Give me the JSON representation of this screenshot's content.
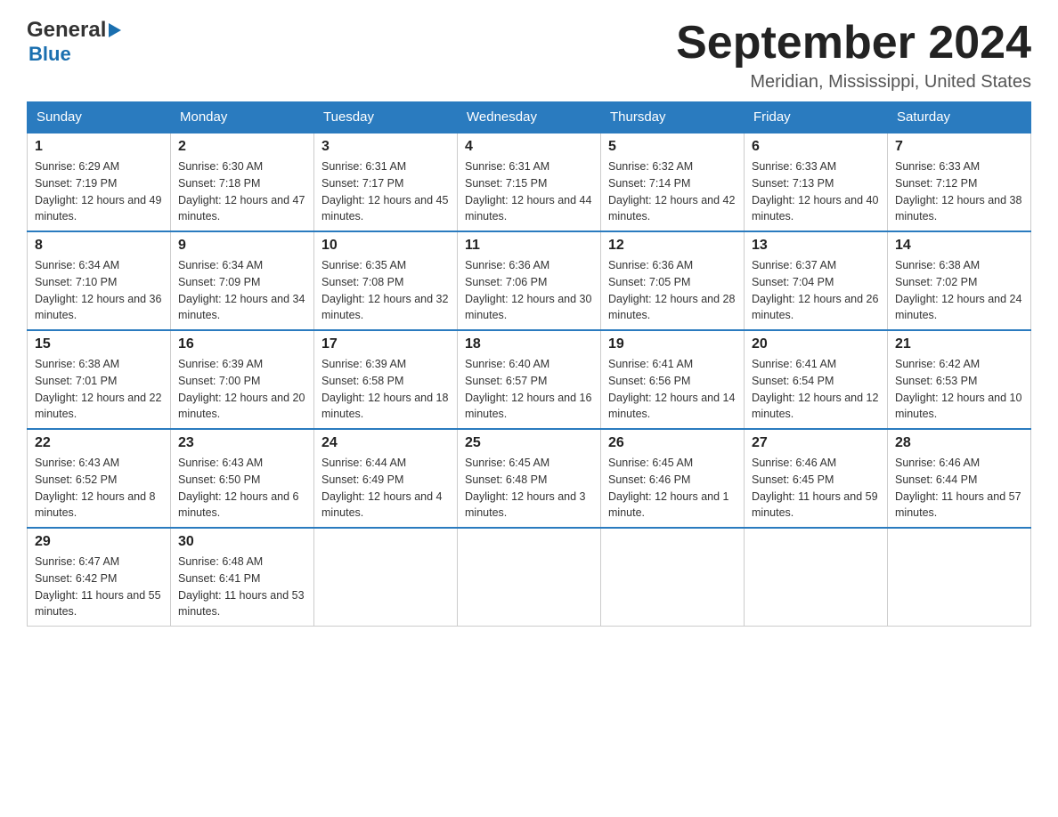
{
  "header": {
    "month_title": "September 2024",
    "location": "Meridian, Mississippi, United States",
    "logo_general": "General",
    "logo_blue": "Blue"
  },
  "days_of_week": [
    "Sunday",
    "Monday",
    "Tuesday",
    "Wednesday",
    "Thursday",
    "Friday",
    "Saturday"
  ],
  "weeks": [
    [
      {
        "day": "1",
        "sunrise": "6:29 AM",
        "sunset": "7:19 PM",
        "daylight": "12 hours and 49 minutes."
      },
      {
        "day": "2",
        "sunrise": "6:30 AM",
        "sunset": "7:18 PM",
        "daylight": "12 hours and 47 minutes."
      },
      {
        "day": "3",
        "sunrise": "6:31 AM",
        "sunset": "7:17 PM",
        "daylight": "12 hours and 45 minutes."
      },
      {
        "day": "4",
        "sunrise": "6:31 AM",
        "sunset": "7:15 PM",
        "daylight": "12 hours and 44 minutes."
      },
      {
        "day": "5",
        "sunrise": "6:32 AM",
        "sunset": "7:14 PM",
        "daylight": "12 hours and 42 minutes."
      },
      {
        "day": "6",
        "sunrise": "6:33 AM",
        "sunset": "7:13 PM",
        "daylight": "12 hours and 40 minutes."
      },
      {
        "day": "7",
        "sunrise": "6:33 AM",
        "sunset": "7:12 PM",
        "daylight": "12 hours and 38 minutes."
      }
    ],
    [
      {
        "day": "8",
        "sunrise": "6:34 AM",
        "sunset": "7:10 PM",
        "daylight": "12 hours and 36 minutes."
      },
      {
        "day": "9",
        "sunrise": "6:34 AM",
        "sunset": "7:09 PM",
        "daylight": "12 hours and 34 minutes."
      },
      {
        "day": "10",
        "sunrise": "6:35 AM",
        "sunset": "7:08 PM",
        "daylight": "12 hours and 32 minutes."
      },
      {
        "day": "11",
        "sunrise": "6:36 AM",
        "sunset": "7:06 PM",
        "daylight": "12 hours and 30 minutes."
      },
      {
        "day": "12",
        "sunrise": "6:36 AM",
        "sunset": "7:05 PM",
        "daylight": "12 hours and 28 minutes."
      },
      {
        "day": "13",
        "sunrise": "6:37 AM",
        "sunset": "7:04 PM",
        "daylight": "12 hours and 26 minutes."
      },
      {
        "day": "14",
        "sunrise": "6:38 AM",
        "sunset": "7:02 PM",
        "daylight": "12 hours and 24 minutes."
      }
    ],
    [
      {
        "day": "15",
        "sunrise": "6:38 AM",
        "sunset": "7:01 PM",
        "daylight": "12 hours and 22 minutes."
      },
      {
        "day": "16",
        "sunrise": "6:39 AM",
        "sunset": "7:00 PM",
        "daylight": "12 hours and 20 minutes."
      },
      {
        "day": "17",
        "sunrise": "6:39 AM",
        "sunset": "6:58 PM",
        "daylight": "12 hours and 18 minutes."
      },
      {
        "day": "18",
        "sunrise": "6:40 AM",
        "sunset": "6:57 PM",
        "daylight": "12 hours and 16 minutes."
      },
      {
        "day": "19",
        "sunrise": "6:41 AM",
        "sunset": "6:56 PM",
        "daylight": "12 hours and 14 minutes."
      },
      {
        "day": "20",
        "sunrise": "6:41 AM",
        "sunset": "6:54 PM",
        "daylight": "12 hours and 12 minutes."
      },
      {
        "day": "21",
        "sunrise": "6:42 AM",
        "sunset": "6:53 PM",
        "daylight": "12 hours and 10 minutes."
      }
    ],
    [
      {
        "day": "22",
        "sunrise": "6:43 AM",
        "sunset": "6:52 PM",
        "daylight": "12 hours and 8 minutes."
      },
      {
        "day": "23",
        "sunrise": "6:43 AM",
        "sunset": "6:50 PM",
        "daylight": "12 hours and 6 minutes."
      },
      {
        "day": "24",
        "sunrise": "6:44 AM",
        "sunset": "6:49 PM",
        "daylight": "12 hours and 4 minutes."
      },
      {
        "day": "25",
        "sunrise": "6:45 AM",
        "sunset": "6:48 PM",
        "daylight": "12 hours and 3 minutes."
      },
      {
        "day": "26",
        "sunrise": "6:45 AM",
        "sunset": "6:46 PM",
        "daylight": "12 hours and 1 minute."
      },
      {
        "day": "27",
        "sunrise": "6:46 AM",
        "sunset": "6:45 PM",
        "daylight": "11 hours and 59 minutes."
      },
      {
        "day": "28",
        "sunrise": "6:46 AM",
        "sunset": "6:44 PM",
        "daylight": "11 hours and 57 minutes."
      }
    ],
    [
      {
        "day": "29",
        "sunrise": "6:47 AM",
        "sunset": "6:42 PM",
        "daylight": "11 hours and 55 minutes."
      },
      {
        "day": "30",
        "sunrise": "6:48 AM",
        "sunset": "6:41 PM",
        "daylight": "11 hours and 53 minutes."
      },
      null,
      null,
      null,
      null,
      null
    ]
  ],
  "labels": {
    "sunrise_prefix": "Sunrise: ",
    "sunset_prefix": "Sunset: ",
    "daylight_prefix": "Daylight: "
  }
}
